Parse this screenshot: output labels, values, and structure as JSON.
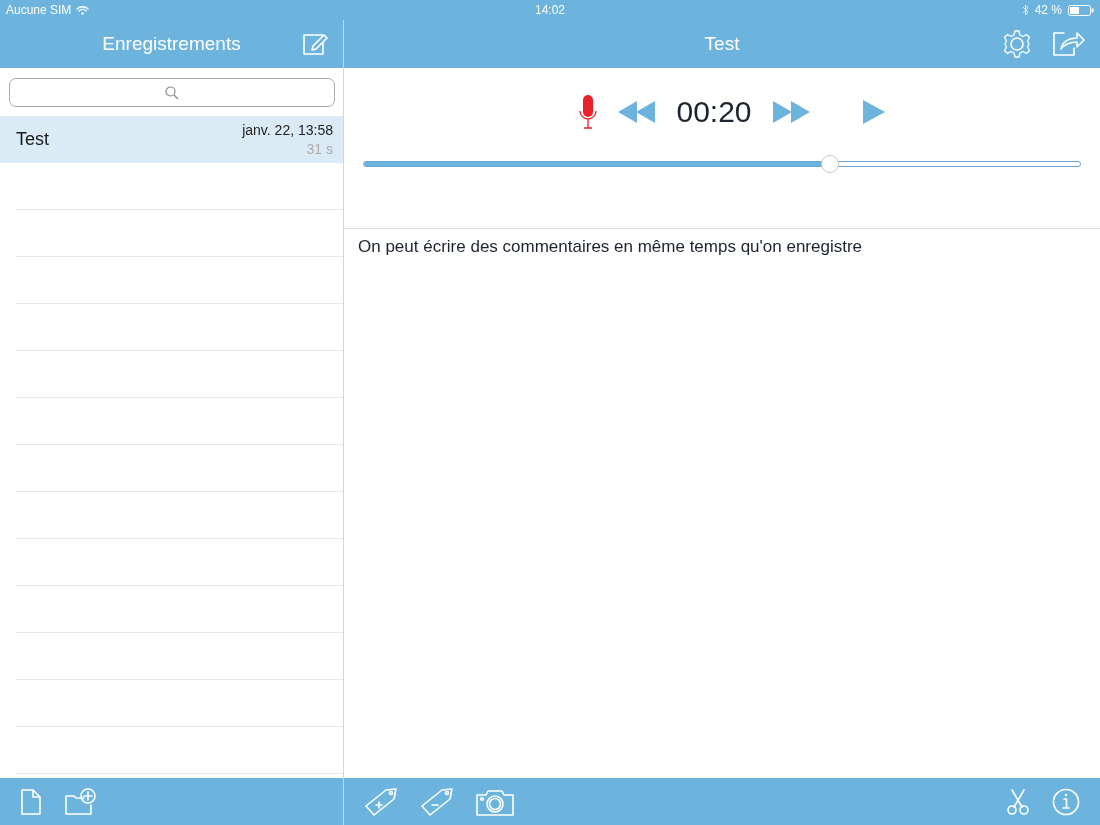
{
  "status_bar": {
    "carrier": "Aucune SIM",
    "time": "14:02",
    "battery": "42 %"
  },
  "sidebar": {
    "title": "Enregistrements",
    "recordings": [
      {
        "title": "Test",
        "date": "janv. 22, 13:58",
        "duration": "31 s",
        "selected": true
      }
    ]
  },
  "detail": {
    "title": "Test",
    "recording": true,
    "time": "00:20",
    "level": 0.65,
    "note": "On peut écrire des commentaires en même temps qu'on enregistre"
  }
}
